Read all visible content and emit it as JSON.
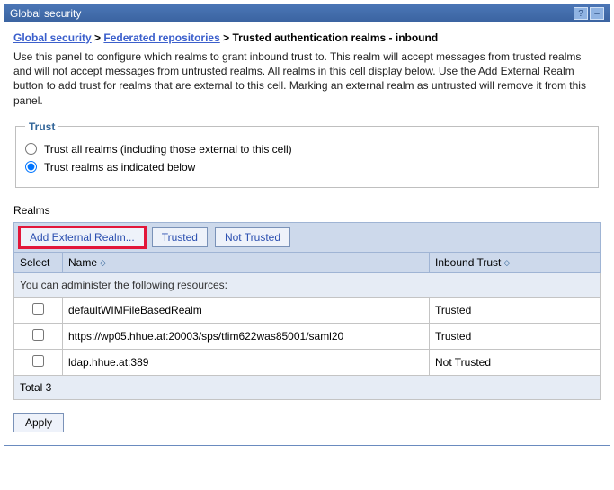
{
  "titlebar": {
    "title": "Global security",
    "help_icon": "?",
    "min_icon": "–"
  },
  "breadcrumb": {
    "link1": "Global security",
    "link2": "Federated repositories",
    "current": "Trusted authentication realms - inbound",
    "sep": ">"
  },
  "description": "Use this panel to configure which realms to grant inbound trust to. This realm will accept messages from trusted realms and will not accept messages from untrusted realms. All realms in this cell display below. Use the Add External Realm button to add trust for realms that are external to this cell. Marking an external realm as untrusted will remove it from this panel.",
  "trust": {
    "legend": "Trust",
    "opt1": "Trust all realms (including those external to this cell)",
    "opt2": "Trust realms as indicated below"
  },
  "realms_label": "Realms",
  "toolbar": {
    "add": "Add External Realm...",
    "trusted": "Trusted",
    "not_trusted": "Not Trusted"
  },
  "table": {
    "col_select": "Select",
    "col_name": "Name",
    "col_inbound": "Inbound Trust",
    "sort_glyph": "◇",
    "subhead": "You can administer the following resources:",
    "rows": [
      {
        "name": "defaultWIMFileBasedRealm",
        "trust": "Trusted"
      },
      {
        "name": "https://wp05.hhue.at:20003/sps/tfim622was85001/saml20",
        "trust": "Trusted"
      },
      {
        "name": "ldap.hhue.at:389",
        "trust": "Not Trusted"
      }
    ],
    "footer": "Total 3"
  },
  "apply": "Apply"
}
